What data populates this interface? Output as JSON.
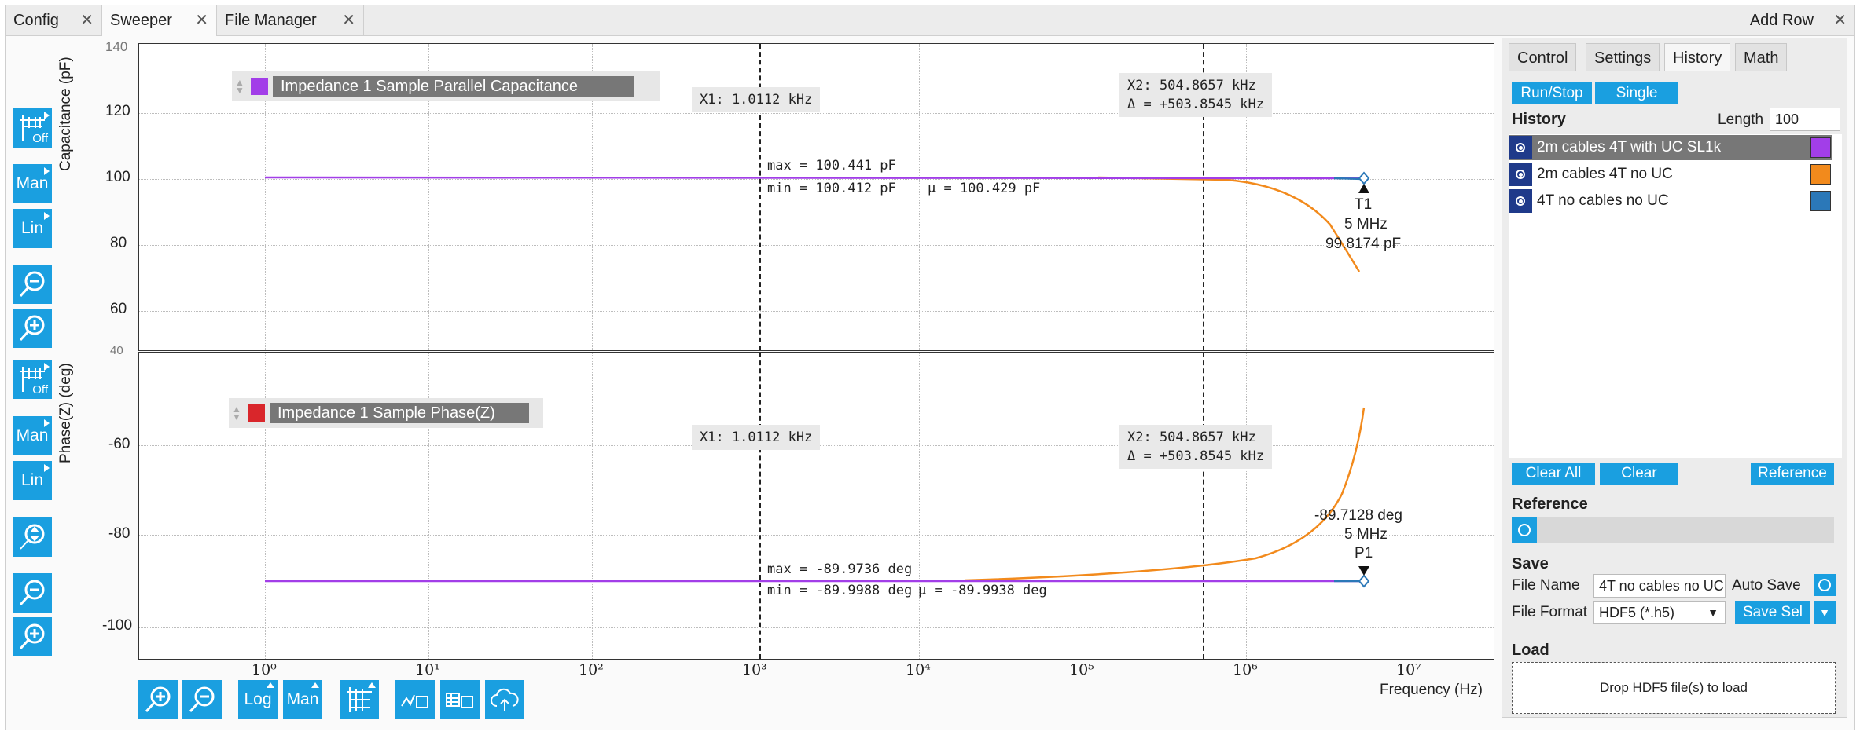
{
  "tabs": [
    {
      "label": "Config"
    },
    {
      "label": "Sweeper"
    },
    {
      "label": "File Manager"
    }
  ],
  "add_row": "Add Row",
  "toolbar": {
    "off": "Off",
    "man": "Man",
    "lin": "Lin",
    "log": "Log"
  },
  "top_plot": {
    "ylabel": "Capacitance (pF)",
    "yticks": [
      "140",
      "120",
      "100",
      "80",
      "60",
      "40"
    ],
    "legend": "Impedance 1 Sample Parallel Capacitance",
    "legend_color": "#a23ee8",
    "x1": "X1: 1.0112 kHz",
    "x2": "X2: 504.8657 kHz",
    "delta": "Δ = +503.8545 kHz",
    "max": "max = 100.441 pF",
    "min": "min = 100.412 pF",
    "mu": "μ = 100.429 pF",
    "marker": {
      "name": "T1",
      "freq": "5 MHz",
      "value": "99.8174 pF"
    }
  },
  "bottom_plot": {
    "ylabel": "Phase(Z) (deg)",
    "yticks": [
      "-60",
      "-80",
      "-100"
    ],
    "legend": "Impedance 1 Sample Phase(Z)",
    "legend_color": "#d9262b",
    "x1": "X1: 1.0112 kHz",
    "x2": "X2: 504.8657 kHz",
    "delta": "Δ = +503.8545 kHz",
    "max": "max = -89.9736 deg",
    "min": "min = -89.9988 deg",
    "mu": "μ = -89.9938 deg",
    "marker": {
      "name": "P1",
      "freq": "5 MHz",
      "value": "-89.7128 deg"
    }
  },
  "xaxis": {
    "label": "Frequency (Hz)",
    "ticks": [
      "10⁰",
      "10¹",
      "10²",
      "10³",
      "10⁴",
      "10⁵",
      "10⁶",
      "10⁷"
    ]
  },
  "panel": {
    "tabs": [
      "Control",
      "Settings",
      "History",
      "Math"
    ],
    "run_stop": "Run/Stop",
    "single": "Single",
    "history_title": "History",
    "length_label": "Length",
    "length_value": "100",
    "history": [
      {
        "name": "2m cables 4T with UC SL1k",
        "color": "#a23ee8"
      },
      {
        "name": "2m cables 4T no UC",
        "color": "#f28a1c"
      },
      {
        "name": "4T no cables no UC",
        "color": "#2b78b8"
      }
    ],
    "clear_all": "Clear All",
    "clear": "Clear",
    "reference_btn": "Reference",
    "reference_title": "Reference",
    "save_title": "Save",
    "file_name_label": "File Name",
    "file_name_value": "4T no cables no UC",
    "auto_save": "Auto Save",
    "file_format_label": "File Format",
    "file_format_value": "HDF5 (*.h5)",
    "save_sel": "Save Sel",
    "load_title": "Load",
    "drop_text": "Drop HDF5 file(s) to load"
  }
}
